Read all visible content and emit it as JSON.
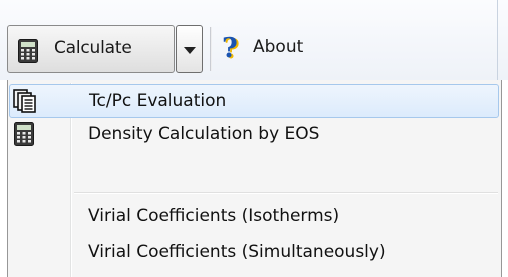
{
  "toolbar": {
    "calculate_label": "Calculate",
    "about_label": "About",
    "calculate_icon": "calculator-icon",
    "dropdown_icon": "chevron-down-icon",
    "about_icon": "help-question-icon"
  },
  "menu": {
    "items": [
      {
        "label": "Tc/Pc Evaluation",
        "icon": "documents-icon",
        "highlighted": true
      },
      {
        "label": "Density Calculation by EOS",
        "icon": "calculator-icon"
      },
      {
        "label": "Virial Coefficients (Isotherms)"
      },
      {
        "label": "Virial Coefficients (Simultaneously)"
      }
    ]
  },
  "colors": {
    "highlight_border": "#a6c8ec",
    "highlight_fill": "#dcebfc",
    "about_icon_blue": "#1b54b0",
    "about_icon_yellow": "#f0b800"
  }
}
